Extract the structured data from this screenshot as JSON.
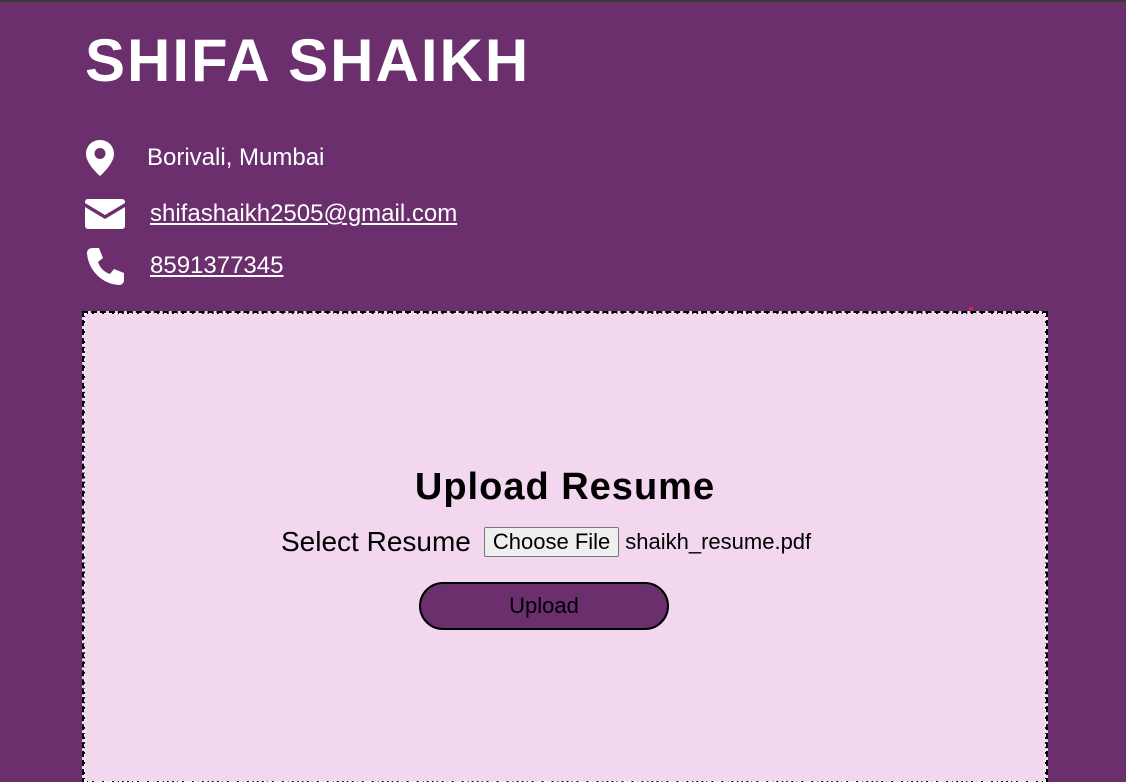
{
  "profile": {
    "name": "SHIFA SHAIKH",
    "location": "Borivali, Mumbai",
    "email": "shifashaikh2505@gmail.com",
    "phone": "8591377345"
  },
  "icons": {
    "location": "map-pin-icon",
    "email": "envelope-icon",
    "phone": "phone-icon"
  },
  "upload": {
    "title": "Upload Resume",
    "select_label": "Select Resume",
    "choose_file_label": "Choose File",
    "file_name": "shaikh_resume.pdf",
    "upload_label": "Upload"
  },
  "colors": {
    "background": "#6b2f6d",
    "panel": "#f2d7ee"
  }
}
